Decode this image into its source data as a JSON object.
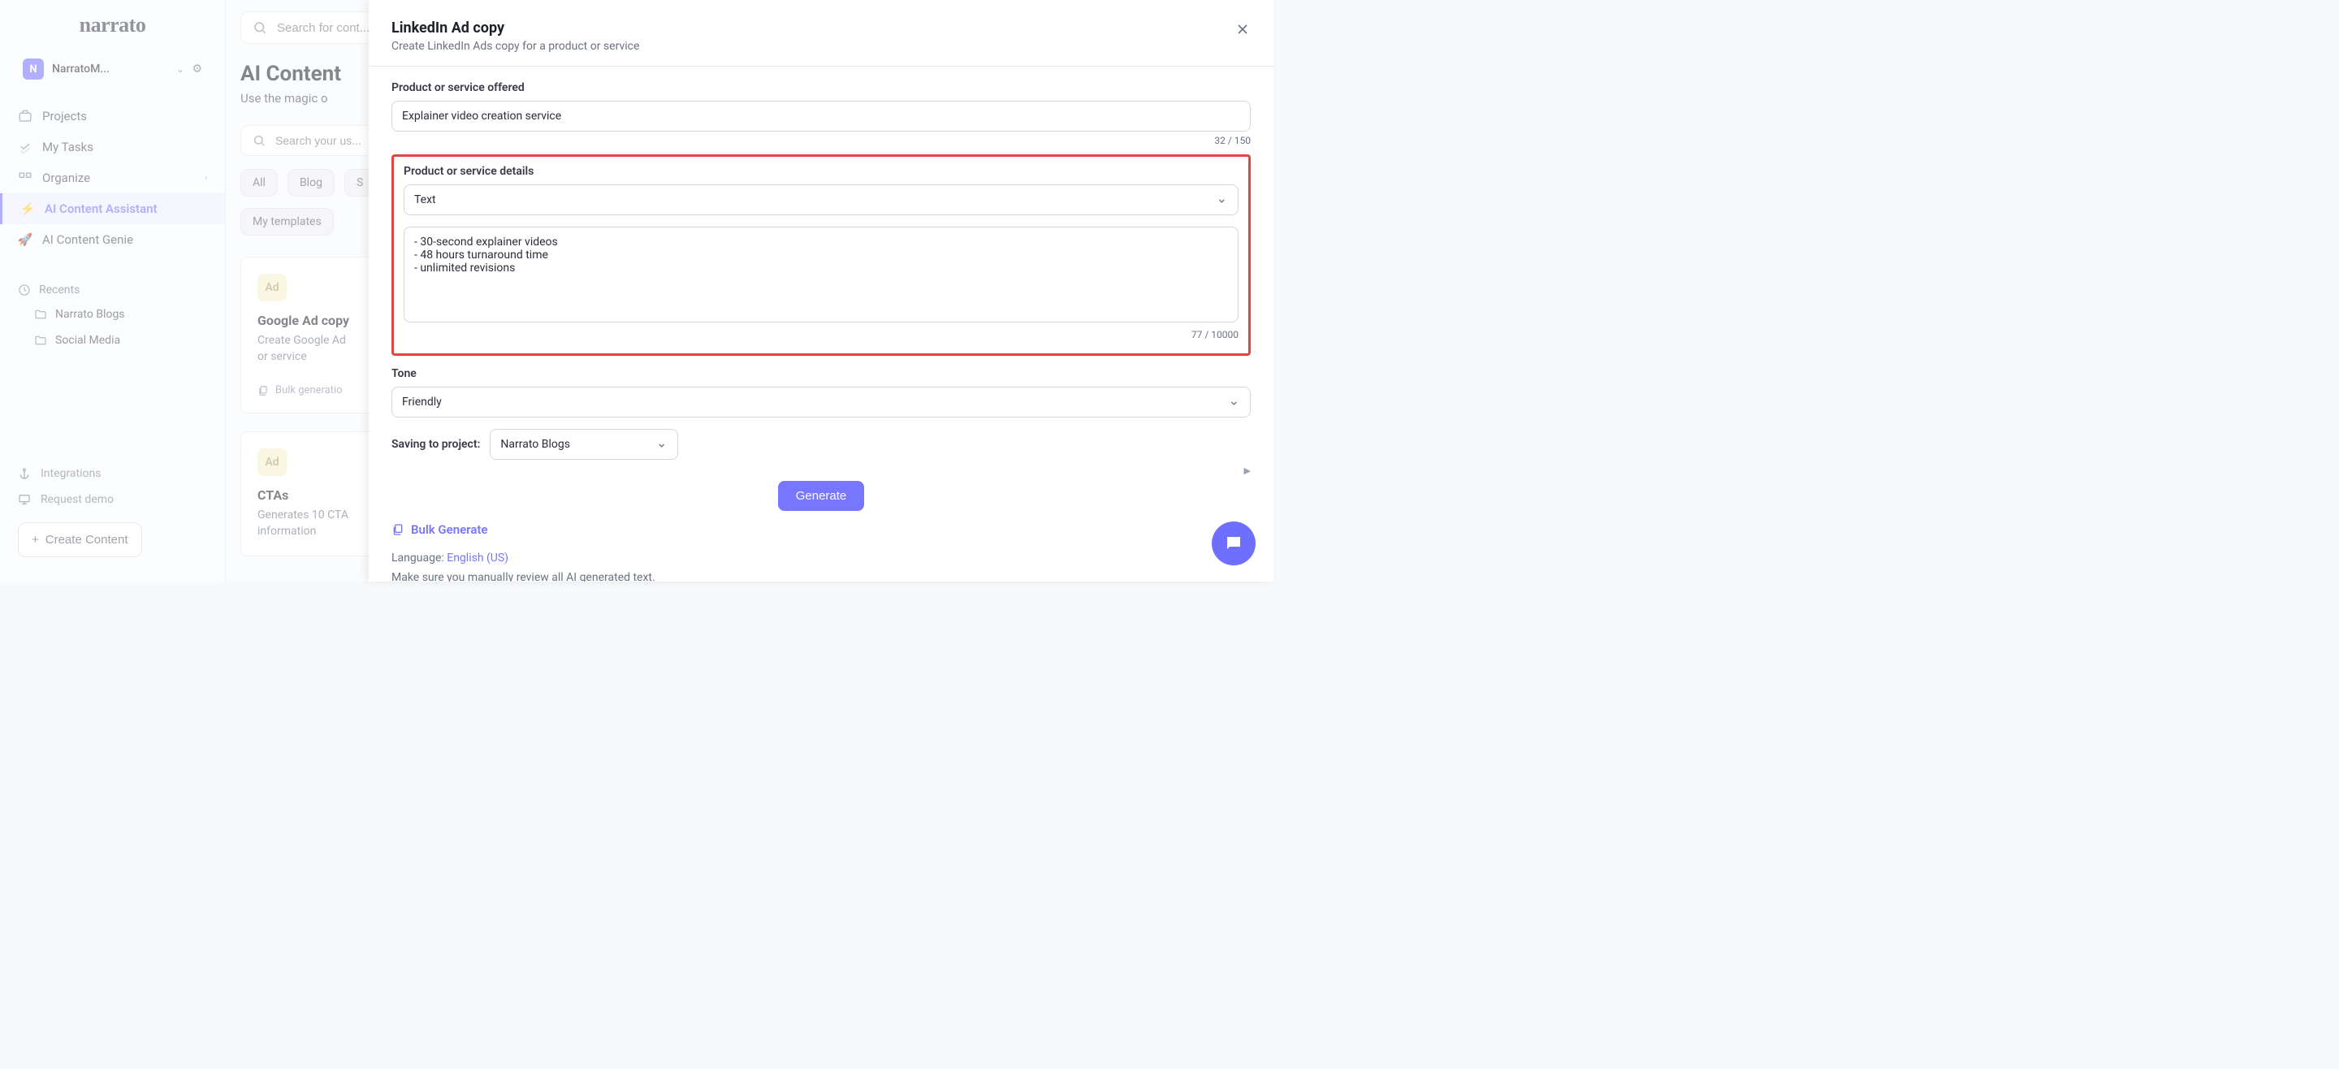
{
  "logo": "narrato",
  "workspace": {
    "badge": "N",
    "name": "NarratoM..."
  },
  "nav": {
    "projects": "Projects",
    "my_tasks": "My Tasks",
    "organize": "Organize",
    "ai_assistant": "AI Content Assistant",
    "ai_genie": "AI Content Genie"
  },
  "recents": {
    "label": "Recents",
    "items": [
      "Narrato Blogs",
      "Social Media"
    ]
  },
  "sidebar_bottom": {
    "integrations": "Integrations",
    "request_demo": "Request demo",
    "create_content": "Create Content"
  },
  "topbar": {
    "search_placeholder": "Search for cont..."
  },
  "page": {
    "title": "AI Content",
    "subtitle": "Use the magic o",
    "search_placeholder": "Search your us..."
  },
  "chips": {
    "all": "All",
    "blog": "Blog",
    "s": "S"
  },
  "chip_mytemplates": "My templates",
  "cards": {
    "google_ad": {
      "title": "Google Ad copy",
      "desc1": "Create Google Ad",
      "desc2": "or service",
      "footer": "Bulk generatio"
    },
    "ctas": {
      "title": "CTAs",
      "desc1": "Generates 10 CTA",
      "desc2": "information"
    }
  },
  "modal": {
    "title": "LinkedIn Ad copy",
    "subtitle": "Create LinkedIn Ads copy for a product or service",
    "product_label": "Product or service offered",
    "product_value": "Explainer video creation service",
    "product_counter": "32 / 150",
    "details_label": "Product or service details",
    "details_select": "Text",
    "details_value": "- 30-second explainer videos\n- 48 hours turnaround time\n- unlimited revisions",
    "details_counter": "77 / 10000",
    "tone_label": "Tone",
    "tone_value": "Friendly",
    "saving_label": "Saving to project:",
    "project_value": "Narrato Blogs",
    "generate": "Generate",
    "bulk_generate": "Bulk Generate",
    "language_label": "Language: ",
    "language_value": "English (US)",
    "review_note": "Make sure you manually review all AI generated text."
  }
}
